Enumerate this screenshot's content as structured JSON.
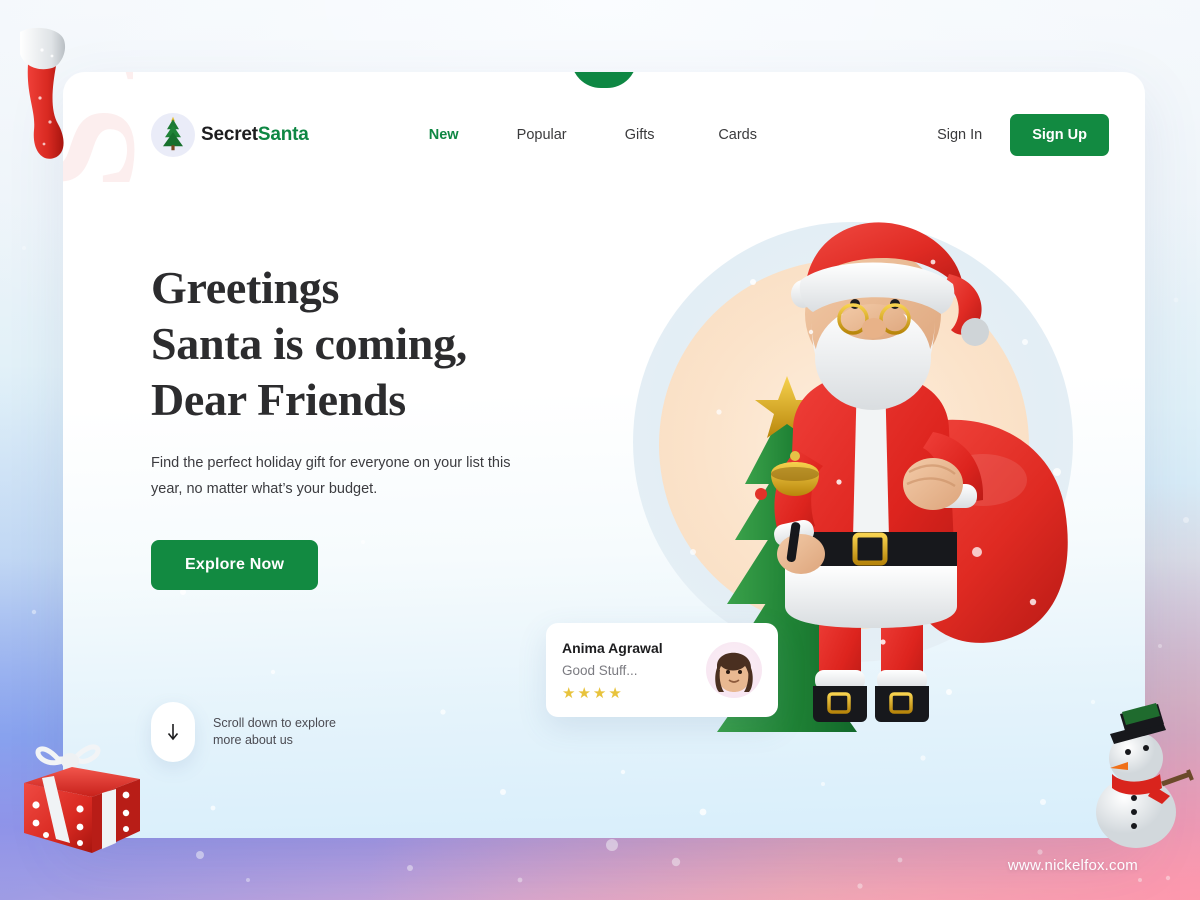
{
  "brand": {
    "name_part1": "Secret",
    "name_part2": "Santa",
    "logo_icon": "christmas-tree-icon"
  },
  "nav": {
    "links": [
      {
        "label": "New",
        "active": true
      },
      {
        "label": "Popular",
        "active": false
      },
      {
        "label": "Gifts",
        "active": false
      },
      {
        "label": "Cards",
        "active": false
      }
    ],
    "sign_in_label": "Sign In",
    "sign_up_label": "Sign Up"
  },
  "hero": {
    "headline_line1": "Greetings",
    "headline_line2": "Santa is coming,",
    "headline_line3": "Dear Friends",
    "subcopy": "Find the perfect holiday gift for everyone on your list this year, no matter what’s your budget.",
    "cta_label": "Explore Now",
    "watermark_text": "SANTA"
  },
  "scroll_hint": {
    "line1": "Scroll down to explore",
    "line2": "more about us",
    "icon": "arrow-down-icon"
  },
  "testimonial": {
    "name": "Anima Agrawal",
    "quote": "Good Stuff...",
    "rating": 4,
    "stars": "★★★★",
    "avatar_icon": "user-avatar-memoji"
  },
  "artwork": {
    "main": "santa-claus-3d-illustration",
    "ornaments": [
      "christmas-stocking",
      "gift-box",
      "snowman"
    ]
  },
  "footer": {
    "site_url": "www.nickelfox.com"
  },
  "colors": {
    "brand_green": "#0e8743",
    "button_green": "#128a41",
    "star_gold": "#e8c33c",
    "headline": "#2c2c2e"
  }
}
